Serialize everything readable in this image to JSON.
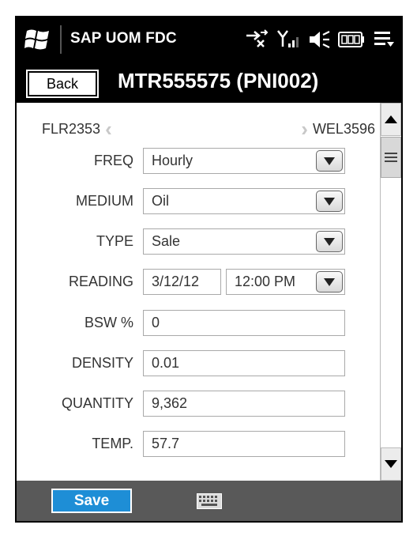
{
  "status_bar": {
    "app_title": "SAP UOM FDC",
    "icons": [
      "windows-logo",
      "data-connection-icon",
      "signal-strength-icon",
      "speaker-muted-icon",
      "battery-icon",
      "menu-icon"
    ]
  },
  "title_bar": {
    "back_label": "Back",
    "title": "MTR555575 (PNI002)"
  },
  "navigation": {
    "prev_label": "FLR2353",
    "next_label": "WEL3596"
  },
  "form": {
    "freq": {
      "label": "FREQ",
      "value": "Hourly"
    },
    "medium": {
      "label": "MEDIUM",
      "value": "Oil"
    },
    "type": {
      "label": "TYPE",
      "value": "Sale"
    },
    "reading": {
      "label": "READING",
      "date": "3/12/12",
      "time": "12:00 PM"
    },
    "bsw": {
      "label": "BSW %",
      "value": "0"
    },
    "density": {
      "label": "DENSITY",
      "value": "0.01"
    },
    "quantity": {
      "label": "QUANTITY",
      "value": "9,362"
    },
    "temp": {
      "label": "TEMP.",
      "value": "57.7"
    }
  },
  "bottom_bar": {
    "save_label": "Save",
    "keyboard_icon": "keyboard-icon"
  },
  "colors": {
    "save_accent": "#1e8ed6",
    "bar_black": "#000000",
    "bottom_bar": "#595959"
  }
}
